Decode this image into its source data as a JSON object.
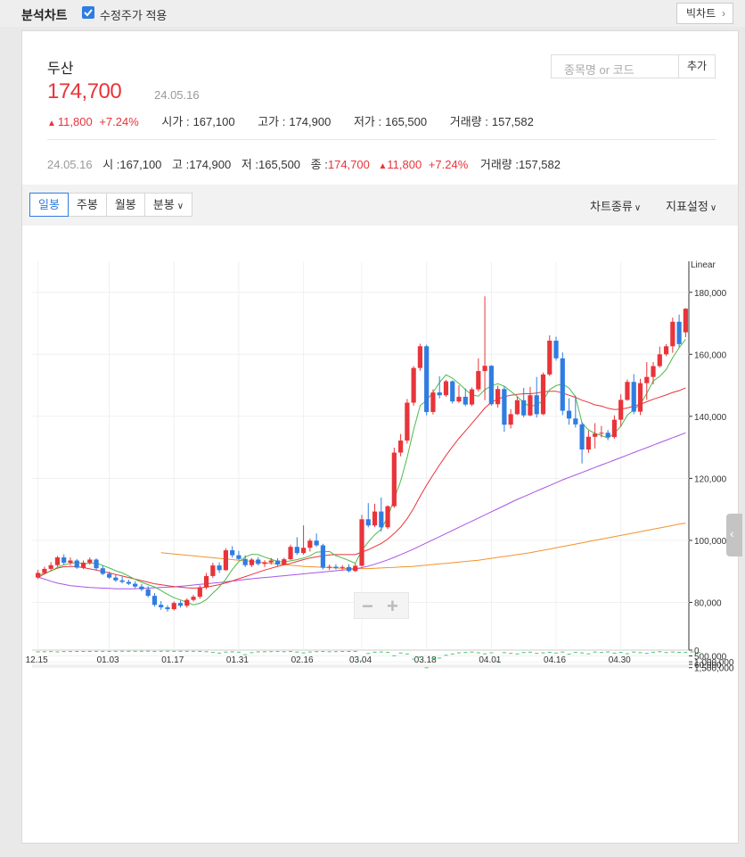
{
  "header": {
    "title": "분석차트",
    "adjusted_label": "수정주가 적용",
    "adjusted_checked": true,
    "big_chart_label": "빅차트"
  },
  "stock": {
    "name": "두산",
    "price": "174,700",
    "date": "24.05.16",
    "change": "11,800",
    "change_pct": "+7.24%",
    "open_label": "시가 :",
    "open": "167,100",
    "high_label": "고가 :",
    "high": "174,900",
    "low_label": "저가 :",
    "low": "165,500",
    "volume_label": "거래량 :",
    "volume": "157,582"
  },
  "search": {
    "placeholder": "종목명 or 코드",
    "add_label": "추가"
  },
  "detail": {
    "date": "24.05.16",
    "open_label": "시 :",
    "open": "167,100",
    "high_label": "고 :",
    "high": "174,900",
    "low_label": "저 :",
    "low": "165,500",
    "close_label": "종 :",
    "close": "174,700",
    "change": "11,800",
    "change_pct": "+7.24%",
    "volume_label": "거래량 :",
    "volume": "157,582"
  },
  "toolbar": {
    "tabs": [
      "일봉",
      "주봉",
      "월봉",
      "분봉"
    ],
    "active_tab": 0,
    "chart_type_label": "차트종류",
    "indicator_label": "지표설정"
  },
  "colors": {
    "up": "#e8343a",
    "down": "#2f7de1",
    "ma5": "#4cbb4c",
    "ma20": "#e8343a",
    "ma60": "#a855e6",
    "ma120": "#f2932c",
    "volume": "#4cc46e"
  },
  "chart_data": {
    "type": "candlestick",
    "scale_label": "Linear",
    "price_ticks": [
      "180,000",
      "160,000",
      "140,000",
      "120,000",
      "100,000",
      "80,000",
      "60,000"
    ],
    "price_tick_values": [
      180000,
      160000,
      140000,
      120000,
      100000,
      80000,
      60000
    ],
    "ylim": [
      60000,
      190000
    ],
    "volume_ticks": [
      "1,500,000",
      "1,000,000",
      "500,000",
      "0"
    ],
    "volume_tick_values": [
      1500000,
      1000000,
      500000,
      0
    ],
    "volume_ylim": [
      0,
      1600000
    ],
    "x_ticks": [
      {
        "label": "12.15",
        "index": 0
      },
      {
        "label": "01.03",
        "index": 11
      },
      {
        "label": "01.17",
        "index": 21
      },
      {
        "label": "01.31",
        "index": 31
      },
      {
        "label": "02.16",
        "index": 41
      },
      {
        "label": "03.04",
        "index": 50
      },
      {
        "label": "03.18",
        "index": 60
      },
      {
        "label": "04.01",
        "index": 70
      },
      {
        "label": "04.16",
        "index": 80
      },
      {
        "label": "04.30",
        "index": 90
      }
    ],
    "candles": [
      [
        88000,
        90500,
        87500,
        89500
      ],
      [
        89500,
        91500,
        89000,
        90800
      ],
      [
        90800,
        93000,
        90200,
        92000
      ],
      [
        92000,
        95000,
        91500,
        94500
      ],
      [
        94500,
        95500,
        92200,
        92800
      ],
      [
        92800,
        94500,
        92000,
        93500
      ],
      [
        93500,
        94000,
        90800,
        91200
      ],
      [
        91200,
        93500,
        90700,
        92800
      ],
      [
        92800,
        94500,
        92200,
        93800
      ],
      [
        93800,
        94200,
        90500,
        91000
      ],
      [
        91000,
        91800,
        88800,
        89200
      ],
      [
        89200,
        89900,
        87600,
        88000
      ],
      [
        88000,
        88900,
        86600,
        87100
      ],
      [
        87100,
        88300,
        86100,
        86600
      ],
      [
        86600,
        87300,
        85600,
        86000
      ],
      [
        86000,
        86800,
        84600,
        85100
      ],
      [
        85100,
        85900,
        83600,
        84200
      ],
      [
        84200,
        85200,
        81600,
        82100
      ],
      [
        82100,
        83000,
        78600,
        79200
      ],
      [
        79200,
        80400,
        77600,
        78400
      ],
      [
        78400,
        79100,
        77000,
        77800
      ],
      [
        77800,
        80300,
        77400,
        79800
      ],
      [
        79800,
        80600,
        78300,
        78900
      ],
      [
        78900,
        81300,
        78300,
        80800
      ],
      [
        80800,
        82400,
        80300,
        81800
      ],
      [
        81800,
        85500,
        81200,
        84800
      ],
      [
        84800,
        89500,
        84200,
        88500
      ],
      [
        88500,
        92800,
        87900,
        91900
      ],
      [
        91900,
        92900,
        89500,
        90400
      ],
      [
        90400,
        97500,
        90200,
        96800
      ],
      [
        96800,
        98100,
        94400,
        95200
      ],
      [
        95200,
        96600,
        93600,
        94000
      ],
      [
        94000,
        95200,
        91400,
        92000
      ],
      [
        92000,
        94300,
        91400,
        93800
      ],
      [
        93800,
        94600,
        91900,
        92400
      ],
      [
        92400,
        93600,
        91400,
        92900
      ],
      [
        92900,
        94300,
        92200,
        93500
      ],
      [
        93500,
        94200,
        91700,
        92200
      ],
      [
        92200,
        94400,
        91900,
        93900
      ],
      [
        93900,
        98600,
        93700,
        97900
      ],
      [
        97900,
        101000,
        95300,
        95900
      ],
      [
        95900,
        104800,
        95400,
        97600
      ],
      [
        97600,
        100600,
        96400,
        99900
      ],
      [
        99900,
        102200,
        97900,
        98400
      ],
      [
        98400,
        98900,
        90600,
        91200
      ],
      [
        91200,
        92200,
        90400,
        91500
      ],
      [
        91500,
        92300,
        90600,
        91100
      ],
      [
        91100,
        92000,
        90300,
        91400
      ],
      [
        91400,
        92300,
        89700,
        90100
      ],
      [
        90100,
        92500,
        89800,
        91800
      ],
      [
        91800,
        108200,
        91500,
        106800
      ],
      [
        106800,
        112000,
        104200,
        104800
      ],
      [
        104800,
        111800,
        104300,
        109300
      ],
      [
        109300,
        113800,
        102800,
        104200
      ],
      [
        104200,
        111300,
        103600,
        111000
      ],
      [
        111000,
        129900,
        110500,
        128300
      ],
      [
        128300,
        134300,
        127100,
        132200
      ],
      [
        132200,
        145600,
        131200,
        144400
      ],
      [
        144400,
        156200,
        143400,
        155600
      ],
      [
        155600,
        163400,
        154700,
        162600
      ],
      [
        162600,
        163100,
        140300,
        141400
      ],
      [
        141400,
        148700,
        140600,
        147700
      ],
      [
        147700,
        152900,
        145800,
        146800
      ],
      [
        146800,
        151800,
        146300,
        151300
      ],
      [
        151300,
        151600,
        144100,
        144800
      ],
      [
        144800,
        150000,
        144300,
        146300
      ],
      [
        146300,
        149000,
        143300,
        143800
      ],
      [
        143800,
        149300,
        143300,
        148700
      ],
      [
        148700,
        158700,
        148000,
        154600
      ],
      [
        154600,
        178700,
        145200,
        156300
      ],
      [
        156300,
        156500,
        143400,
        143900
      ],
      [
        143900,
        149900,
        142800,
        148800
      ],
      [
        148800,
        149700,
        135000,
        137300
      ],
      [
        137300,
        142300,
        136100,
        140700
      ],
      [
        140700,
        146300,
        140400,
        145200
      ],
      [
        145200,
        149200,
        139700,
        140300
      ],
      [
        140300,
        149500,
        140000,
        146800
      ],
      [
        146800,
        152700,
        139600,
        140700
      ],
      [
        140700,
        154100,
        140400,
        153500
      ],
      [
        153500,
        166100,
        153000,
        164400
      ],
      [
        164400,
        165700,
        158000,
        158700
      ],
      [
        158700,
        160600,
        140400,
        141800
      ],
      [
        141800,
        145800,
        137300,
        139300
      ],
      [
        139300,
        146700,
        136400,
        137400
      ],
      [
        137400,
        138200,
        124800,
        129300
      ],
      [
        129300,
        135400,
        128200,
        133400
      ],
      [
        133400,
        137800,
        129600,
        134400
      ],
      [
        134400,
        136900,
        133200,
        134700
      ],
      [
        134700,
        135600,
        132300,
        133300
      ],
      [
        133300,
        140300,
        132800,
        138900
      ],
      [
        138900,
        147100,
        136700,
        145300
      ],
      [
        145300,
        151900,
        145000,
        151100
      ],
      [
        151100,
        153600,
        140700,
        141500
      ],
      [
        141500,
        152100,
        140400,
        150700
      ],
      [
        150700,
        157500,
        145300,
        152700
      ],
      [
        152700,
        157500,
        150300,
        156200
      ],
      [
        156200,
        162500,
        155700,
        160000
      ],
      [
        160000,
        163300,
        159400,
        162600
      ],
      [
        162600,
        171800,
        160500,
        170500
      ],
      [
        170500,
        172800,
        162300,
        163300
      ],
      [
        167100,
        174900,
        165500,
        174700
      ]
    ],
    "volumes": [
      110000,
      100000,
      90000,
      115000,
      88000,
      85000,
      80000,
      78000,
      75000,
      70000,
      68000,
      72000,
      65000,
      60000,
      62000,
      58000,
      60000,
      55000,
      70000,
      60000,
      55000,
      62000,
      58000,
      65000,
      60000,
      70000,
      100000,
      160000,
      220000,
      130000,
      110000,
      140000,
      350000,
      180000,
      110000,
      100000,
      90000,
      85000,
      95000,
      80000,
      130000,
      200000,
      120000,
      90000,
      80000,
      100000,
      90000,
      80000,
      75000,
      70000,
      880000,
      250000,
      140000,
      120000,
      160000,
      440000,
      210000,
      290000,
      730000,
      550000,
      1470000,
      680000,
      640000,
      400000,
      300000,
      200000,
      170000,
      130000,
      190000,
      280000,
      190000,
      900000,
      180000,
      240000,
      290000,
      170000,
      140000,
      240000,
      200000,
      150000,
      210000,
      130000,
      300000,
      160000,
      200000,
      280000,
      130000,
      170000,
      120000,
      220000,
      160000,
      270000,
      130000,
      180000,
      240000,
      140000,
      100000,
      170000,
      120000,
      150000,
      160000,
      120000,
      157582
    ],
    "ma5": {
      "start": 0,
      "values": [
        88700,
        89400,
        90100,
        91300,
        92100,
        92600,
        92900,
        92500,
        92600,
        92700,
        91900,
        91100,
        90200,
        89500,
        88500,
        87400,
        86500,
        85700,
        85000,
        83800,
        82600,
        81500,
        80800,
        80000,
        79200,
        79700,
        80900,
        83000,
        85000,
        87500,
        90600,
        93100,
        94600,
        95500,
        95400,
        94600,
        93900,
        93200,
        93000,
        93400,
        93800,
        94300,
        95000,
        96200,
        96300,
        96400,
        95100,
        94300,
        93500,
        92600,
        96800,
        99500,
        101800,
        103600,
        107500,
        113300,
        119100,
        126800,
        135600,
        143400,
        145200,
        147700,
        150900,
        153400,
        152300,
        150600,
        148600,
        146900,
        146500,
        148600,
        149800,
        150500,
        149700,
        148100,
        146400,
        144300,
        143200,
        143700,
        145100,
        148600,
        149900,
        150400,
        149100,
        146300,
        137900,
        135600,
        134500,
        133800,
        133000,
        134500,
        136800,
        140400,
        142100,
        143900,
        147400,
        151400,
        152900,
        155100,
        158900,
        162100,
        164900
      ]
    },
    "ma20": {
      "start": 0,
      "values": [
        88000,
        89200,
        90200,
        91000,
        91500,
        91600,
        91500,
        91200,
        90800,
        90400,
        90000,
        89500,
        89000,
        88500,
        88000,
        87500,
        87000,
        86500,
        86000,
        85700,
        85400,
        85100,
        84900,
        84700,
        84600,
        84700,
        84900,
        85300,
        85700,
        86300,
        86900,
        87600,
        88300,
        89000,
        89700,
        90400,
        91000,
        91600,
        92100,
        92600,
        93200,
        93800,
        94300,
        94700,
        95000,
        95300,
        95400,
        95400,
        95400,
        95400,
        96200,
        97000,
        98000,
        99000,
        100400,
        102200,
        104300,
        107000,
        110300,
        114200,
        117800,
        121100,
        124300,
        127400,
        130200,
        132900,
        135300,
        137700,
        140200,
        142700,
        144500,
        145600,
        146300,
        146800,
        147100,
        147300,
        147300,
        147500,
        147900,
        148100,
        148100,
        147500,
        146800,
        146100,
        145200,
        144500,
        143700,
        143300,
        142600,
        142200,
        142300,
        142700,
        143300,
        143900,
        144700,
        145500,
        146200,
        146900,
        147700,
        148300,
        149200
      ]
    },
    "ma60": {
      "start": 0,
      "values": [
        88200,
        87500,
        86800,
        86200,
        85800,
        85400,
        85200,
        85000,
        84800,
        84700,
        84600,
        84500,
        84400,
        84400,
        84400,
        84400,
        84500,
        84600,
        84700,
        84800,
        84900,
        85000,
        85200,
        85400,
        85600,
        85800,
        86000,
        86200,
        86400,
        86600,
        86900,
        87100,
        87400,
        87600,
        87800,
        88000,
        88200,
        88400,
        88600,
        88800,
        89000,
        89200,
        89400,
        89600,
        89800,
        90000,
        90200,
        90400,
        90600,
        90800,
        91200,
        91700,
        92300,
        93000,
        93700,
        94500,
        95400,
        96300,
        97200,
        98200,
        99200,
        100200,
        101200,
        102200,
        103200,
        104200,
        105200,
        106200,
        107200,
        108200,
        109200,
        110200,
        111200,
        112200,
        113200,
        114100,
        115000,
        115900,
        116800,
        117700,
        118600,
        119500,
        120300,
        121100,
        121900,
        122700,
        123500,
        124300,
        125100,
        125900,
        126700,
        127500,
        128300,
        129100,
        129900,
        130700,
        131500,
        132300,
        133100,
        133900,
        134700
      ]
    },
    "ma120": {
      "start": 19,
      "values": [
        96000,
        95800,
        95600,
        95400,
        95200,
        95000,
        94800,
        94600,
        94400,
        94200,
        94000,
        93800,
        93600,
        93400,
        93200,
        93000,
        92800,
        92600,
        92400,
        92200,
        92000,
        91800,
        91600,
        91500,
        91400,
        91300,
        91200,
        91100,
        91000,
        90900,
        90900,
        90900,
        90900,
        91000,
        91100,
        91200,
        91300,
        91400,
        91500,
        91600,
        91800,
        92000,
        92200,
        92400,
        92600,
        92800,
        93000,
        93200,
        93400,
        93600,
        93900,
        94200,
        94500,
        94800,
        95100,
        95400,
        95700,
        96000,
        96400,
        96800,
        97200,
        97600,
        98000,
        98400,
        98800,
        99200,
        99600,
        100000,
        100400,
        100800,
        101200,
        101600,
        102000,
        102400,
        102800,
        103200,
        103600,
        104000,
        104400,
        104800,
        105200,
        105600
      ]
    }
  }
}
